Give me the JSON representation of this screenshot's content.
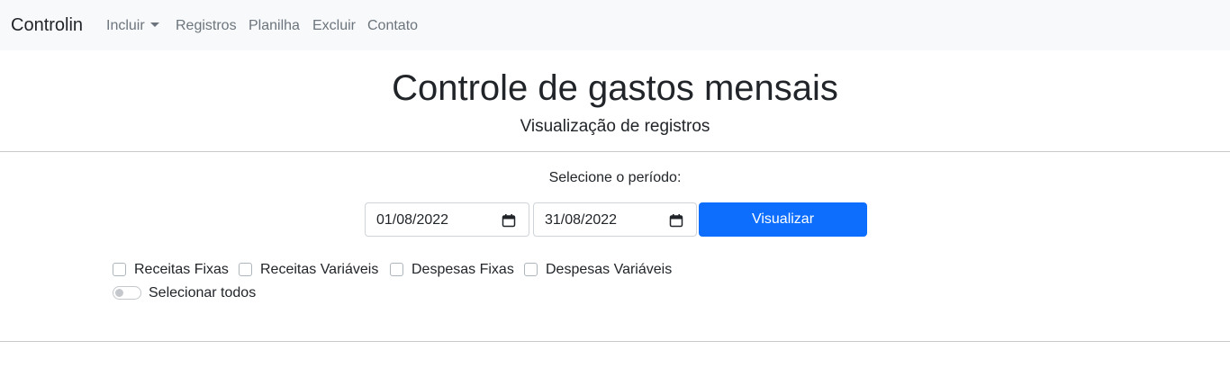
{
  "navbar": {
    "brand": "Controlin",
    "items": [
      {
        "label": "Incluir"
      },
      {
        "label": "Registros"
      },
      {
        "label": "Planilha"
      },
      {
        "label": "Excluir"
      },
      {
        "label": "Contato"
      }
    ]
  },
  "header": {
    "title": "Controle de gastos mensais",
    "subtitle": "Visualização de registros"
  },
  "period": {
    "label": "Selecione o período:",
    "start_date": "01/08/2022",
    "end_date": "31/08/2022",
    "button_label": "Visualizar"
  },
  "filters": {
    "checkboxes": [
      {
        "label": "Receitas Fixas",
        "checked": false
      },
      {
        "label": "Receitas Variáveis",
        "checked": false
      },
      {
        "label": "Despesas Fixas",
        "checked": false
      },
      {
        "label": "Despesas Variáveis",
        "checked": false
      }
    ],
    "select_all": {
      "label": "Selecionar todos",
      "on": false
    }
  },
  "colors": {
    "primary": "#0d6efd",
    "navbar_bg": "#f8f9fa",
    "text": "#212529",
    "muted": "#6c757d"
  }
}
